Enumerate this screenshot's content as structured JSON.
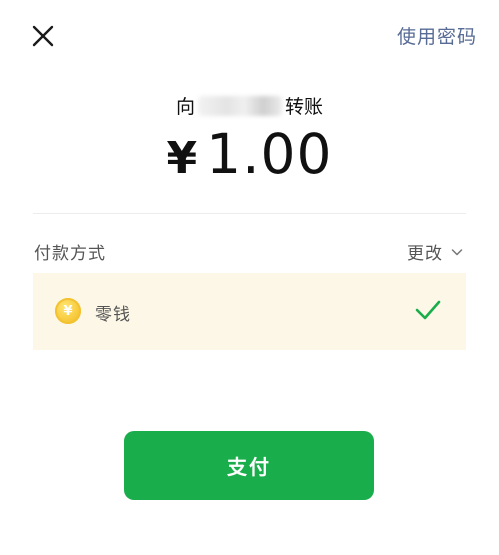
{
  "header": {
    "close_icon": "close-icon",
    "use_password_label": "使用密码"
  },
  "transfer": {
    "prefix": "向",
    "suffix": "转账",
    "currency_symbol": "¥",
    "amount": "1.00"
  },
  "payment_method": {
    "label": "付款方式",
    "change_label": "更改",
    "selected_option": {
      "icon": "yuan-coin-icon",
      "icon_glyph": "¥",
      "label": "零钱",
      "check_icon": "checkmark-icon"
    }
  },
  "actions": {
    "pay_label": "支付"
  },
  "colors": {
    "accent": "#1aad4c",
    "link": "#576b95",
    "option_bg": "#fcf7e6"
  }
}
